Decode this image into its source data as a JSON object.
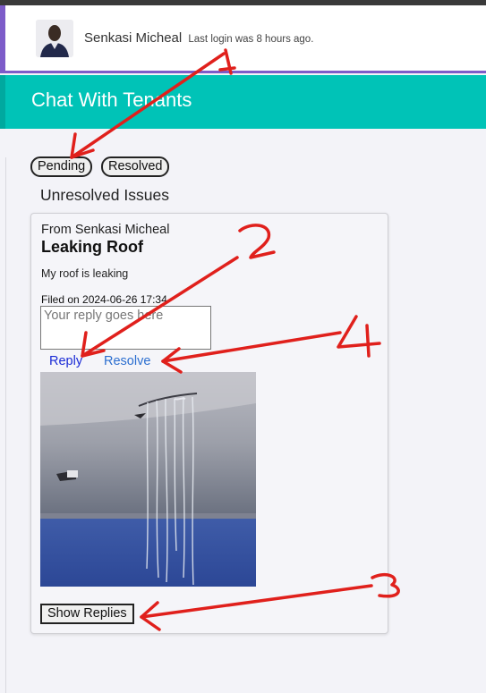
{
  "header": {
    "user_name": "Senkasi Micheal",
    "last_login": "Last login was 8 hours ago.",
    "accent_color": "#7d5cc9"
  },
  "banner": {
    "title": "Chat With Tenants",
    "color": "#00c3b7"
  },
  "tabs": {
    "pending_label": "Pending",
    "resolved_label": "Resolved"
  },
  "section_title": "Unresolved Issues",
  "issue": {
    "from": "From Senkasi Micheal",
    "title": "Leaking Roof",
    "body": "My roof is leaking",
    "filed": "Filed on 2024-06-26 17:34",
    "reply_placeholder": "Your reply goes here",
    "reply_label": "Reply",
    "resolve_label": "Resolve",
    "show_replies_label": "Show Replies"
  },
  "annotations": {
    "color": "#e0201c",
    "labels": [
      "1",
      "2",
      "3",
      "4"
    ]
  }
}
